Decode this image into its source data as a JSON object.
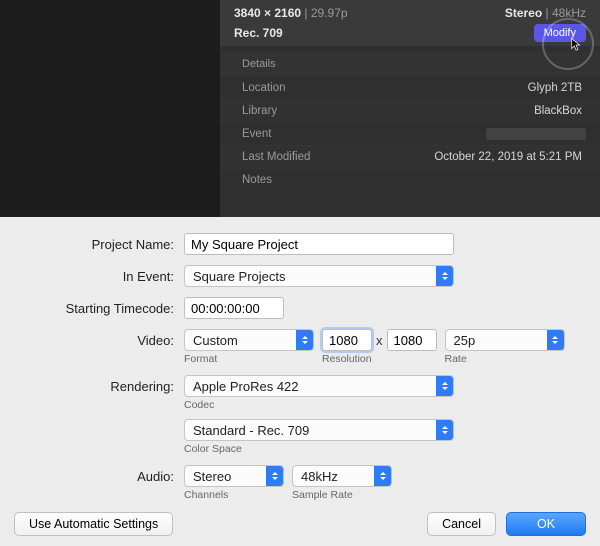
{
  "info": {
    "resolution": "3840 × 2160",
    "fps": "29.97p",
    "audio_mode": "Stereo",
    "audio_rate": "48kHz",
    "color_profile": "Rec. 709",
    "modify_label": "Modify",
    "details_label": "Details",
    "rows": {
      "location_label": "Location",
      "location_value": "Glyph 2TB",
      "library_label": "Library",
      "library_value": "BlackBox",
      "event_label": "Event",
      "last_modified_label": "Last Modified",
      "last_modified_value": "October 22, 2019 at 5:21 PM",
      "notes_label": "Notes"
    }
  },
  "dialog": {
    "labels": {
      "project_name": "Project Name:",
      "in_event": "In Event:",
      "starting_timecode": "Starting Timecode:",
      "video": "Video:",
      "rendering": "Rendering:",
      "audio": "Audio:",
      "format": "Format",
      "resolution": "Resolution",
      "rate": "Rate",
      "codec": "Codec",
      "color_space": "Color Space",
      "channels": "Channels",
      "sample_rate": "Sample Rate"
    },
    "values": {
      "project_name": "My Square Project",
      "in_event": "Square Projects",
      "starting_timecode": "00:00:00:00",
      "video_format": "Custom",
      "video_width": "1080",
      "video_height": "1080",
      "video_rate": "25p",
      "rendering_codec": "Apple ProRes 422",
      "rendering_colorspace": "Standard - Rec. 709",
      "audio_channels": "Stereo",
      "audio_sample_rate": "48kHz"
    },
    "buttons": {
      "auto": "Use Automatic Settings",
      "cancel": "Cancel",
      "ok": "OK"
    },
    "x_sep": "x"
  }
}
